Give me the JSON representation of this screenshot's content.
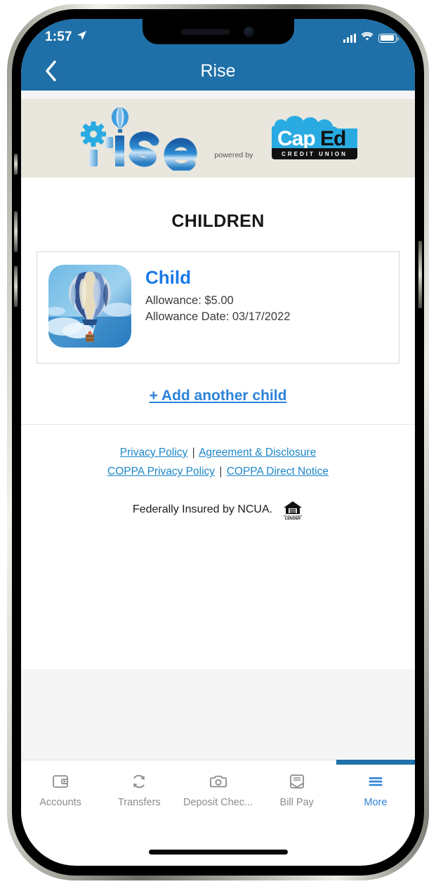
{
  "status_bar": {
    "time": "1:57",
    "location_icon": "location-arrow-icon",
    "cellular_icon": "cellular-signal-icon",
    "wifi_icon": "wifi-icon",
    "battery_icon": "battery-icon"
  },
  "nav_bar": {
    "back_icon": "chevron-left-icon",
    "title": "Rise"
  },
  "banner": {
    "app_logo_text": "ise",
    "app_logo_icons": [
      "gear-icon",
      "hot-air-balloon-icon"
    ],
    "powered_by": "powered by",
    "partner_logo": {
      "name_light": "Cap",
      "name_dark": "Ed",
      "subtitle": "CREDIT UNION"
    }
  },
  "main": {
    "section_title": "CHILDREN",
    "children": [
      {
        "avatar_icon": "hot-air-balloon-avatar",
        "name": "Child",
        "allowance": "Allowance: $5.00",
        "allowance_date": "Allowance Date: 03/17/2022"
      }
    ],
    "add_child_label": "+ Add another child"
  },
  "footer": {
    "links": [
      {
        "label": "Privacy Policy"
      },
      {
        "label": "Agreement & Disclosure"
      },
      {
        "label": "COPPA Privacy Policy"
      },
      {
        "label": "COPPA Direct Notice"
      }
    ],
    "separator": "|",
    "ncua_text": "Federally Insured by NCUA.",
    "ehl_icon": "equal-housing-lender-icon",
    "ehl_label": "LENDER"
  },
  "tab_bar": {
    "items": [
      {
        "label": "Accounts",
        "icon": "wallet-icon",
        "active": false
      },
      {
        "label": "Transfers",
        "icon": "refresh-icon",
        "active": false
      },
      {
        "label": "Deposit Chec...",
        "icon": "camera-icon",
        "active": false
      },
      {
        "label": "Bill Pay",
        "icon": "envelope-icon",
        "active": false
      },
      {
        "label": "More",
        "icon": "hamburger-icon",
        "active": true
      }
    ]
  },
  "colors": {
    "header_blue": "#1f70a8",
    "link_blue": "#1c87c9",
    "accent_blue": "#2c83d8",
    "child_name_blue": "#1a7ae8",
    "banner_beige": "#e8e6dd",
    "caped_cyan": "#29abe2"
  }
}
